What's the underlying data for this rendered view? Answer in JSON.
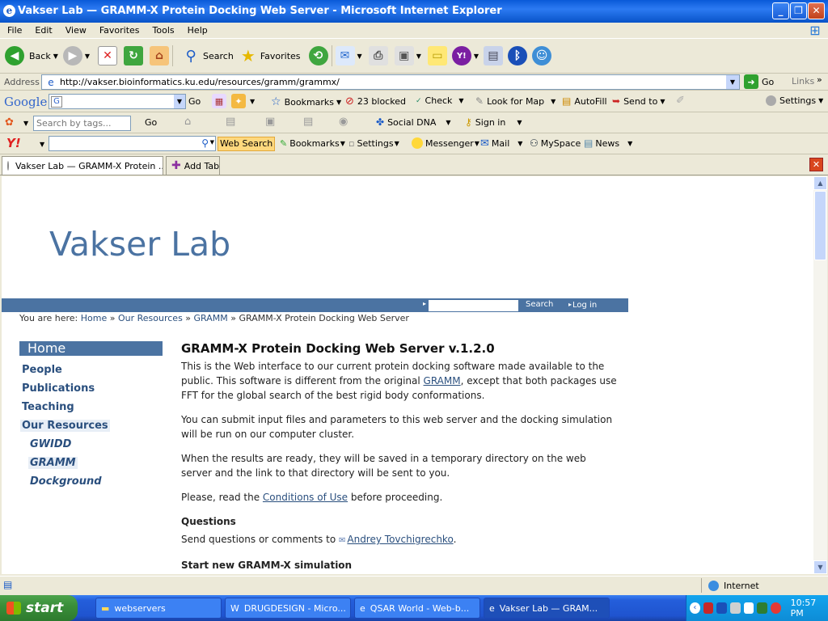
{
  "window": {
    "title": "Vakser Lab — GRAMM-X Protein Docking Web Server - Microsoft Internet Explorer"
  },
  "menu": [
    "File",
    "Edit",
    "View",
    "Favorites",
    "Tools",
    "Help"
  ],
  "toolbar": {
    "back": "Back",
    "search": "Search",
    "favorites": "Favorites"
  },
  "address": {
    "label": "Address",
    "url": "http://vakser.bioinformatics.ku.edu/resources/gramm/grammx/",
    "go": "Go",
    "links": "Links"
  },
  "google_bar": {
    "logo": "Google",
    "go": "Go",
    "bookmarks": "Bookmarks",
    "blocked": "23 blocked",
    "check": "Check",
    "look_for_map": "Look for Map",
    "autofill": "AutoFill",
    "send_to": "Send to",
    "settings": "Settings"
  },
  "tags_bar": {
    "placeholder": "Search by tags...",
    "go": "Go",
    "social_dna": "Social DNA",
    "sign_in": "Sign in"
  },
  "yahoo_bar": {
    "logo": "Y!",
    "web_search": "Web Search",
    "bookmarks": "Bookmarks",
    "settings": "Settings",
    "messenger": "Messenger",
    "mail": "Mail",
    "myspace": "MySpace",
    "news": "News"
  },
  "tabs": {
    "active": "Vakser Lab — GRAMM-X Protein ...",
    "add": "Add Tab"
  },
  "page": {
    "lab_title": "Vakser Lab",
    "search_button": "Search",
    "login": "Log in",
    "breadcrumb": {
      "prefix": "You are here:",
      "items": [
        "Home",
        "Our Resources",
        "GRAMM"
      ],
      "current": "GRAMM-X Protein Docking Web Server",
      "sep": "»"
    },
    "sidebar": {
      "home": "Home",
      "items": [
        "People",
        "Publications",
        "Teaching",
        "Our Resources"
      ],
      "sub_items": [
        "GWIDD",
        "GRAMM",
        "Dockground"
      ]
    },
    "heading": "GRAMM-X Protein Docking Web Server v.1.2.0",
    "para1_a": "This is the Web interface to our current protein docking software made available to the public. This software is different from the original ",
    "para1_link": "GRAMM",
    "para1_b": ", except that both packages use FFT for the global search of the best rigid body conformations.",
    "para2": "You can submit input files and parameters to this web server and the docking simulation will be run on our computer cluster.",
    "para3": "When the results are ready, they will be saved in a temporary directory on the web server and the link to that directory will be sent to you.",
    "para4_a": "Please, read the ",
    "para4_link": "Conditions of Use",
    "para4_b": " before proceeding.",
    "questions_heading": "Questions",
    "questions_a": "Send questions or comments to ",
    "questions_link": "Andrey Tovchigrechko",
    "questions_b": ".",
    "start_heading": "Start new GRAMM-X simulation"
  },
  "status": {
    "zone": "Internet"
  },
  "taskbar": {
    "start": "start",
    "tasks": [
      "webservers",
      "DRUGDESIGN - Micro...",
      "QSAR World - Web-b...",
      "Vakser Lab — GRAM..."
    ],
    "clock": "10:57 PM"
  },
  "colors": {
    "brand": "#4b73a2",
    "link": "#2a4f7e",
    "xp_blue": "#0a5ad8"
  }
}
